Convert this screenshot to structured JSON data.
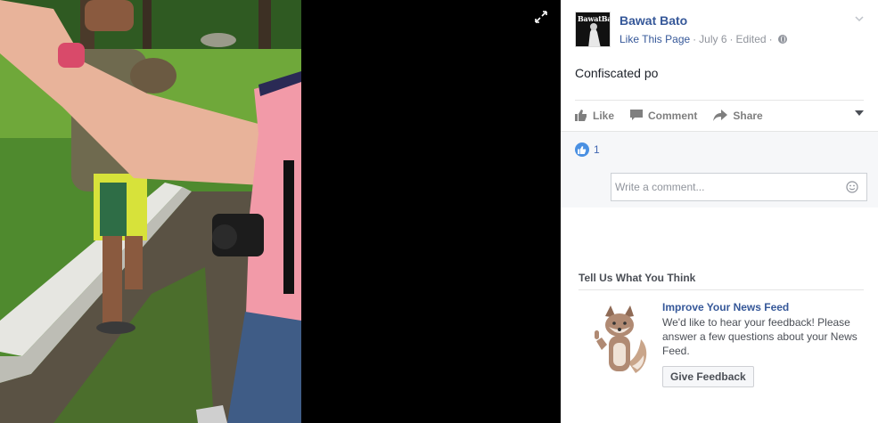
{
  "post": {
    "avatar_text": "BawatBato",
    "page_name": "Bawat Bato",
    "like_page_label": "Like This Page",
    "date": "July 6",
    "edited_label": "Edited",
    "text": "Confiscated po"
  },
  "actions": {
    "like": "Like",
    "comment": "Comment",
    "share": "Share"
  },
  "reactions": {
    "like_count": "1"
  },
  "comment_input": {
    "placeholder": "Write a comment..."
  },
  "feedback_prompt": {
    "section_title": "Tell Us What You Think",
    "title": "Improve Your News Feed",
    "body": "We'd like to hear your feedback! Please answer a few questions about your News Feed.",
    "button_label": "Give Feedback"
  },
  "icons": {
    "expand": "expand-icon",
    "options": "chevron-down-icon",
    "privacy": "globe-icon",
    "emoji": "emoji-icon"
  },
  "colors": {
    "link": "#365899",
    "like_badge": "#4a90e2",
    "viewer_bg": "#000000"
  }
}
